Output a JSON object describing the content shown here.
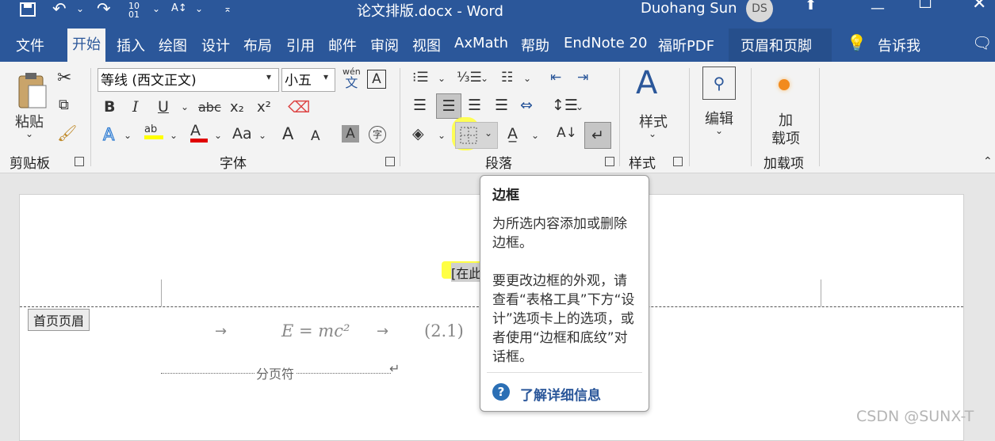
{
  "window": {
    "title": "论文排版.docx - Word",
    "user_name": "Duohang Sun",
    "user_initials": "DS"
  },
  "tabs": [
    "文件",
    "开始",
    "插入",
    "绘图",
    "设计",
    "布局",
    "引用",
    "邮件",
    "审阅",
    "视图",
    "AxMath",
    "帮助",
    "EndNote 20",
    "福昕PDF",
    "页眉和页脚"
  ],
  "active_tab": "开始",
  "tell_me": "告诉我",
  "ribbon": {
    "clipboard": {
      "paste_label": "粘贴",
      "group_label": "剪贴板"
    },
    "font": {
      "font_name": "等线 (西文正文)",
      "font_size": "小五",
      "wen_label": "wén",
      "wen_char": "文",
      "bold": "B",
      "italic": "I",
      "underline": "U",
      "strike": "abc",
      "sub": "x₂",
      "sup": "x²",
      "text_effect": "A",
      "highlight": "ab",
      "font_color": "A",
      "change_case": "Aa",
      "grow": "A",
      "shrink": "A",
      "char_shade": "A",
      "enclose": "字",
      "boxed_a": "A",
      "group_label": "字体"
    },
    "paragraph": {
      "group_label": "段落"
    },
    "styles": {
      "label": "样式",
      "group_label": "样式"
    },
    "editing": {
      "label": "编辑"
    },
    "addins": {
      "label_line1": "加",
      "label_line2": "载项",
      "group_label": "加载项"
    }
  },
  "document": {
    "header_placeholder": "[在此",
    "header_tag": "首页页眉",
    "equation_text": "E = mc²",
    "equation_number": "(2.1)",
    "arrow_mark": "→",
    "page_break_label": "分页符",
    "return_mark": "↵"
  },
  "tooltip": {
    "title": "边框",
    "desc1": "为所选内容添加或删除边框。",
    "desc2": "要更改边框的外观，请查看“表格工具”下方“设计”选项卡上的选项，或者使用“边框和底纹”对话框。",
    "link": "了解详细信息"
  },
  "watermark": "CSDN @SUNX-T",
  "colors": {
    "accent": "#2b579a",
    "highlight": "#ffff00",
    "font_color": "#e00000"
  }
}
